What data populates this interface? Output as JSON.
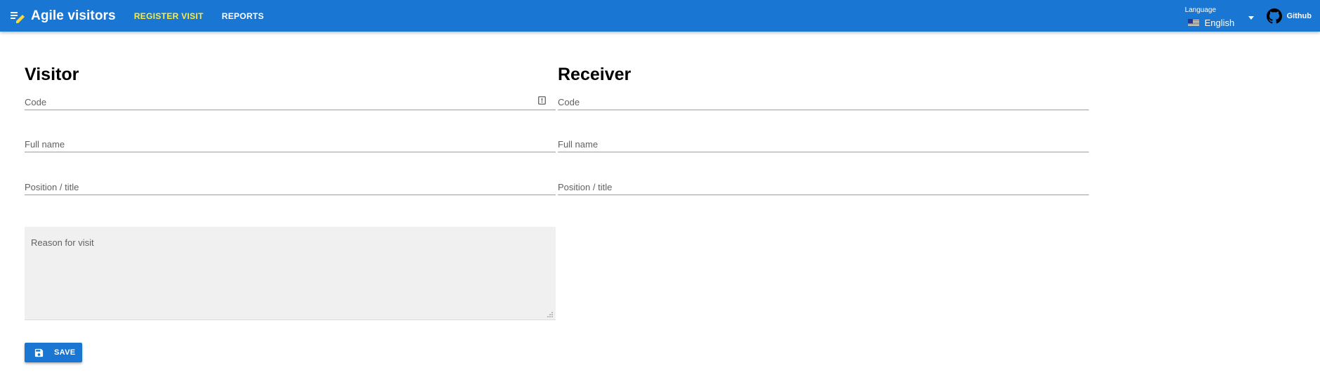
{
  "appbar": {
    "title": "Agile visitors",
    "nav": [
      {
        "label": "REGISTER VISIT",
        "active": true
      },
      {
        "label": "REPORTS",
        "active": false
      }
    ],
    "language": {
      "label": "Language",
      "value": "English",
      "flag": "us-flag-icon"
    },
    "github_label": "Github",
    "colors": {
      "bar": "#1976d2",
      "active_tab": "#ffeb3b"
    }
  },
  "visitor": {
    "title": "Visitor",
    "fields": {
      "code": "Code",
      "full_name": "Full name",
      "position": "Position / title"
    },
    "reason_label": "Reason for visit"
  },
  "receiver": {
    "title": "Receiver",
    "fields": {
      "code": "Code",
      "full_name": "Full name",
      "position": "Position / title"
    }
  },
  "save_label": "SAVE"
}
